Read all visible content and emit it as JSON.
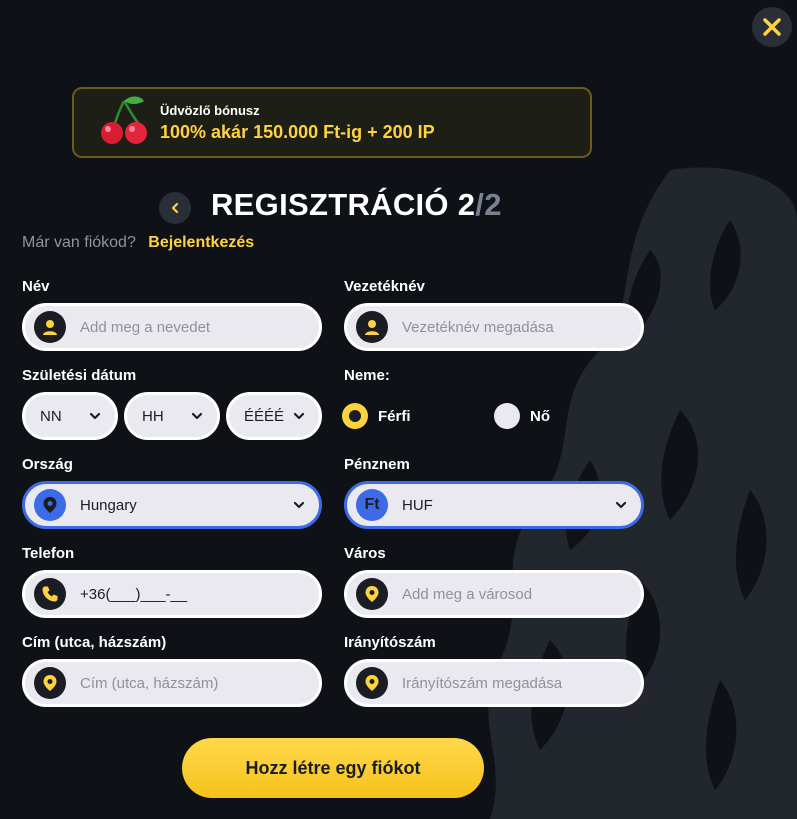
{
  "bonus": {
    "small": "Üdvözlő bónusz",
    "big": "100% akár 150.000 Ft-ig + 200 IP"
  },
  "header": {
    "title_main": "REGISZTRÁCIÓ 2",
    "title_suffix": "/2",
    "login_question": "Már van fiókod?",
    "login_link": "Bejelentkezés"
  },
  "form": {
    "first_name": {
      "label": "Név",
      "placeholder": "Add meg a nevedet"
    },
    "last_name": {
      "label": "Vezetéknév",
      "placeholder": "Vezetéknév megadása"
    },
    "birth_date": {
      "label": "Születési dátum",
      "day": "NN",
      "month": "HH",
      "year": "ÉÉÉÉ"
    },
    "gender": {
      "label": "Neme:",
      "male": "Férfi",
      "female": "Nő",
      "selected": "male"
    },
    "country": {
      "label": "Ország",
      "value": "Hungary"
    },
    "currency": {
      "label": "Pénznem",
      "value": "HUF",
      "icon_text": "Ft"
    },
    "phone": {
      "label": "Telefon",
      "value": "+36(___)___-__"
    },
    "city": {
      "label": "Város",
      "placeholder": "Add meg a városod"
    },
    "address": {
      "label": "Cím (utca, házszám)",
      "placeholder": "Cím (utca, házszám)"
    },
    "zip": {
      "label": "Irányítószám",
      "placeholder": "Irányítószám megadása"
    }
  },
  "submit_label": "Hozz létre egy fiókot",
  "colors": {
    "accent": "#ffd23f",
    "focus": "#3d6be8",
    "background": "#0e1217"
  },
  "icons": {
    "close": "close-icon",
    "back": "chevron-left-icon",
    "user": "user-icon",
    "location": "location-pin-icon",
    "phone": "phone-icon",
    "chevron": "chevron-down-icon",
    "cherry": "cherry-icon"
  }
}
